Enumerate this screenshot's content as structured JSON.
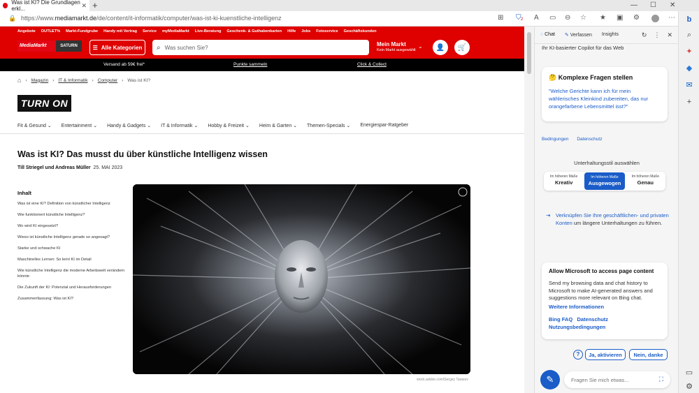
{
  "browser": {
    "tab_title": "Was ist KI? Die Grundlagen erkl...",
    "tab_close": "✕",
    "new_tab": "+",
    "url_prefix": "https://www.",
    "url_domain": "mediamarkt.de",
    "url_path": "/de/content/it-informatik/computer/was-ist-ki-kuenstliche-intelligenz",
    "shield_badge": "2"
  },
  "header": {
    "top_links": [
      "Angebote",
      "OUTLET%",
      "Markt-Fundgrube",
      "Handy mit Vertrag",
      "Service",
      "myMediaMarkt",
      "Live-Beratung",
      "Geschenk- & Guthabenkarten",
      "Hilfe",
      "Jobs",
      "Fotoservice",
      "Geschäftskunden"
    ],
    "logo_left": "MediaMarkt",
    "logo_right": "SATURN",
    "categories_label": "Alle Kategorien",
    "search_placeholder": "Was suchen Sie?",
    "market_title": "Mein Markt",
    "market_sub": "Kein Markt ausgewählt"
  },
  "promo": {
    "shipping": "Versand ab 59€ frei*",
    "points": "Punkte sammeln",
    "click_collect": "Click & Collect"
  },
  "breadcrumb": [
    "Magazin",
    "IT & Informatik",
    "Computer",
    "Was ist KI?"
  ],
  "brand": "TURN ON",
  "nav": [
    "Fit & Gesund",
    "Entertainment",
    "Handy & Gadgets",
    "IT & Informatik",
    "Hobby & Freizeit",
    "Heim & Garten",
    "Themen-Specials",
    "Energiespar-Ratgeber"
  ],
  "article": {
    "title": "Was ist KI? Das musst du über künstliche Intelligenz wissen",
    "authors": "Till Striegel und Andreas Müller",
    "date": "25. MAI 2023",
    "toc_heading": "Inhalt",
    "toc": [
      "Was ist eine KI? Definition von künstlicher Intelligenz",
      "Wie funktioniert künstliche Intelligenz?",
      "Wo wird KI eingesetzt?",
      "Wieso ist künstliche Intelligenz gerade so angesagt?",
      "Starke und schwache KI",
      "Maschinelles Lernen: So lernt KI im Detail",
      "Wie künstliche Intelligenz die moderne Arbeitswelt verändern könnte",
      "Die Zukunft der KI: Potenzial und Herausforderungen",
      "Zusammenfassung: Was ist KI?"
    ],
    "image_credit": "stock.adobe.com/Sergey Tarasov"
  },
  "sidebar": {
    "tabs": [
      "Chat",
      "Verfassen",
      "Insights"
    ],
    "subtitle": "Ihr KI-basierter Copilot für das Web",
    "card_title": "Komplexe Fragen stellen",
    "card_question": "\"Welche Gerichte kann ich für mein wählerisches Kleinkind zubereiten, das nur orangefarbene Lebensmittel isst?\"",
    "terms": "Bedingungen",
    "privacy": "Datenschutz",
    "style_heading": "Unterhaltungsstil auswählen",
    "styles": [
      {
        "sub": "Im höheren Maße",
        "label": "Kreativ"
      },
      {
        "sub": "Im höheren Maße",
        "label": "Ausgewogen"
      },
      {
        "sub": "Im höheren Maße",
        "label": "Genau"
      }
    ],
    "connect_link": "Verknüpfen Sie Ihre geschäftlichen- und privaten Konten",
    "connect_rest": " um längere Unterhaltungen zu führen.",
    "access_title": "Allow Microsoft to access page content",
    "access_desc": "Send my browsing data and chat history to Microsoft to make AI-generated answers and suggestions more relevant on Bing chat.",
    "more_info": "Weitere Informationen",
    "bing_faq": "Bing FAQ",
    "datenschutz": "Datenschutz",
    "nutzungs": "Nutzungsbedingungen",
    "btn_yes": "Ja, aktivieren",
    "btn_no": "Nein, danke",
    "chat_placeholder": "Fragen Sie mich etwas..."
  },
  "colors": {
    "mm_red": "#df0000",
    "bing_blue": "#1a5cc8"
  }
}
